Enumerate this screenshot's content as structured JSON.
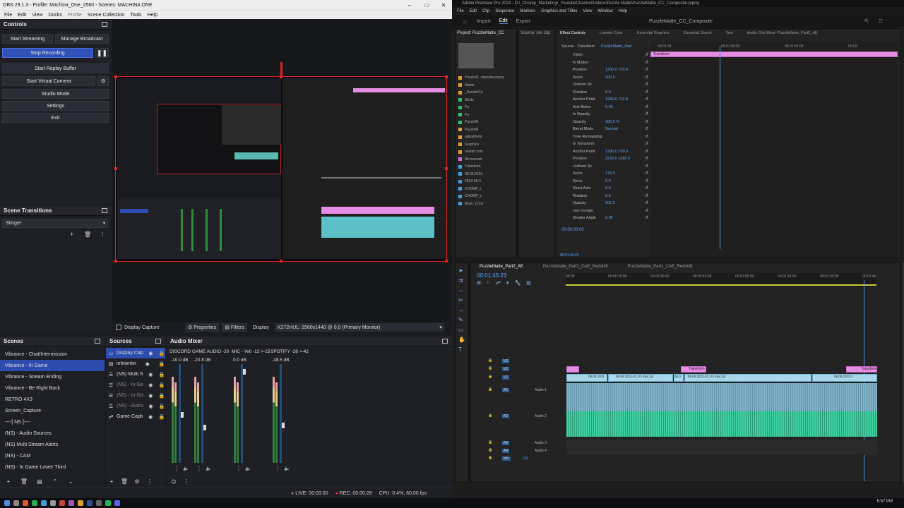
{
  "obs": {
    "title": "OBS 29.1.3 - Profile: Machina_One_2560 - Scenes: MACHINA ONE",
    "menu": [
      "File",
      "Edit",
      "View",
      "Docks",
      "Profile",
      "Scene Collection",
      "Tools",
      "Help"
    ],
    "controls": {
      "header": "Controls",
      "start_streaming": "Start Streaming",
      "manage_broadcast": "Manage Broadcast",
      "stop_recording": "Stop Recording",
      "start_replay_buffer": "Start Replay Buffer",
      "start_virtual_camera": "Start Virtual Camera",
      "studio_mode": "Studio Mode",
      "settings": "Settings",
      "exit": "Exit"
    },
    "transitions": {
      "header": "Scene Transitions",
      "selected": "Stinger"
    },
    "source_bar": {
      "name": "Display Capture",
      "properties": "Properties",
      "filters": "Filters",
      "display_label": "Display",
      "display_value": "K272HUL: 2560x1440 @ 0,0 (Primary Monitor)"
    },
    "scenes": {
      "header": "Scenes",
      "items": [
        "Vibrance - Chat/Intermission",
        "Vibrance - In Game",
        "Vibrance - Stream Ending",
        "Vibrance - Be Right Back",
        "RETRO 4X3",
        "Screen_Capture",
        "----[ NS ]----",
        "(NS) - Audio Sources",
        "(NS) Multi Stream Alerts",
        "(NS) - CAM",
        "(NS) - In Game Lower Third"
      ],
      "selected_index": 1
    },
    "sources": {
      "header": "Sources",
      "items": [
        "Display Cap",
        "infowriter",
        "(NS) Multi S",
        "(NS) - In Ga",
        "(NS) - In Ga",
        "(NS) - Audio",
        "Game Capti"
      ]
    },
    "mixer": {
      "header": "Audio Mixer",
      "channels": [
        {
          "name": "DISCORD",
          "db": "-10.0 dB",
          "level": 0.48
        },
        {
          "name": "GAME AUDIO -20",
          "db": "-20.8 dB",
          "level": 0.34
        },
        {
          "name": "MIC - Yeti -12 >-15",
          "db": "0.0 dB",
          "level": 0.95
        },
        {
          "name": "SPOTIFY -28 >-42",
          "db": "-18.5 dB",
          "level": 0.36
        }
      ]
    },
    "status": {
      "live": "LIVE: 00:00:00",
      "rec": "REC: 00:00:28",
      "cpu": "CPU: 0.4%, 60.00 fps"
    }
  },
  "premiere": {
    "title": "Adobe Premiere Pro 2023 - D:\\_Chomp_Marketing\\_YoutubeChannel\\Videos\\Puzzle Matte\\PuzzleMatte_CC_Composite.prproj",
    "menu": [
      "File",
      "Edit",
      "Clip",
      "Sequence",
      "Markers",
      "Graphics and Titles",
      "View",
      "Window",
      "Help"
    ],
    "workspaces": [
      "Import",
      "Edit",
      "Export"
    ],
    "active_workspace": "Edit",
    "doc_title": "PuzzleMatte_CC_Composite",
    "project_tab": "Project: PuzzleMatte_CC",
    "source_tab": "Source: (no clip",
    "effect_tabs": [
      "Effect Controls",
      "Lumetri Color",
      "Essential Graphics",
      "Essential Sound",
      "Text",
      "Audio Clip Mixer: PuzzleMatte_Part2_AE"
    ],
    "ec_source": "Source - Transform",
    "ec_clip": "PuzzleMatte_Part",
    "ec_time": "00:00:00:00",
    "ec_time_bottom": "00:01:45:23",
    "ec_ruler": [
      "00:01:00",
      "00:01:30:00",
      "00:01:55:00",
      "00:02:"
    ],
    "ec_rows": [
      {
        "label": "Video"
      },
      {
        "label": "fx  Motion"
      },
      {
        "label": "Position",
        "val": "1280.0   720.0"
      },
      {
        "label": "Scale",
        "val": "100.0"
      },
      {
        "label": "Uniform Sc"
      },
      {
        "label": "Rotation",
        "val": "0.0"
      },
      {
        "label": "Anchor Point",
        "val": "1280.0   720.0"
      },
      {
        "label": "Anti-flicker",
        "val": "0.00"
      },
      {
        "label": "fx  Opacity"
      },
      {
        "label": "Opacity",
        "val": "100.0 %"
      },
      {
        "label": "Blend Mode",
        "val": "Normal"
      },
      {
        "label": "Time Remapping"
      },
      {
        "label": "fx  Transform"
      },
      {
        "label": "Anchor Point",
        "val": "1280.0   720.0"
      },
      {
        "label": "Position",
        "val": "2225.0   1360.0"
      },
      {
        "label": "Uniform Sc"
      },
      {
        "label": "Scale",
        "val": "175.0"
      },
      {
        "label": "Skew",
        "val": "0.0"
      },
      {
        "label": "Skew Axis",
        "val": "0.0"
      },
      {
        "label": "Rotation",
        "val": "0.0"
      },
      {
        "label": "Opacity",
        "val": "100.0"
      },
      {
        "label": "Use Compo"
      },
      {
        "label": "Shutter Angle",
        "val": "0.00"
      }
    ],
    "ec_clip_bar": "Transform",
    "project_items": [
      "PuzzleM...mposite.prproj",
      "Name",
      "_RenderCo",
      "Shots",
      "Pu",
      "Pu",
      "PuzzleM",
      "PuzzleM",
      "adjustment",
      "Graphics",
      "nested com",
      "Recovered",
      "Transform",
      "08.05.2023",
      "2023-08-0",
      "CHOMP_L",
      "CHOMP_L",
      "Ryan_Chon"
    ],
    "seq_tabs": [
      "PuzzleMatte_Part2_AE",
      "PuzzleMatte_Part1_CAE_Redshift",
      "PuzzleMatte_Part1_CAE_Redshift"
    ],
    "seq_time": "00:01:45:23",
    "seq_ruler": [
      "00:00",
      "00:00:15:00",
      "00:00:30:00",
      "00:00:45:00",
      "00:01:00:00",
      "00:01:15:00",
      "00:01:30:00",
      "00:01:45"
    ],
    "track_labels": [
      "V3",
      "V2",
      "V1",
      "A1",
      "A2",
      "A3",
      "A4",
      "Mix"
    ],
    "audio_track_names": [
      "Audio 1",
      "Audio 2",
      "Audio 3",
      "Audio 4"
    ],
    "mix_val": "0.0",
    "clip_labels": {
      "transform": "Transform",
      "v1a": "08.05.2023",
      "v1b": "08.05.2023-10_00.mp4 [V]",
      "v1c": "08.0",
      "v1d": "08.05.2023-10_00.mp4 [V]",
      "v1e": "08.05.2023-1"
    }
  },
  "taskbar": {
    "time": "5:57 PM"
  }
}
